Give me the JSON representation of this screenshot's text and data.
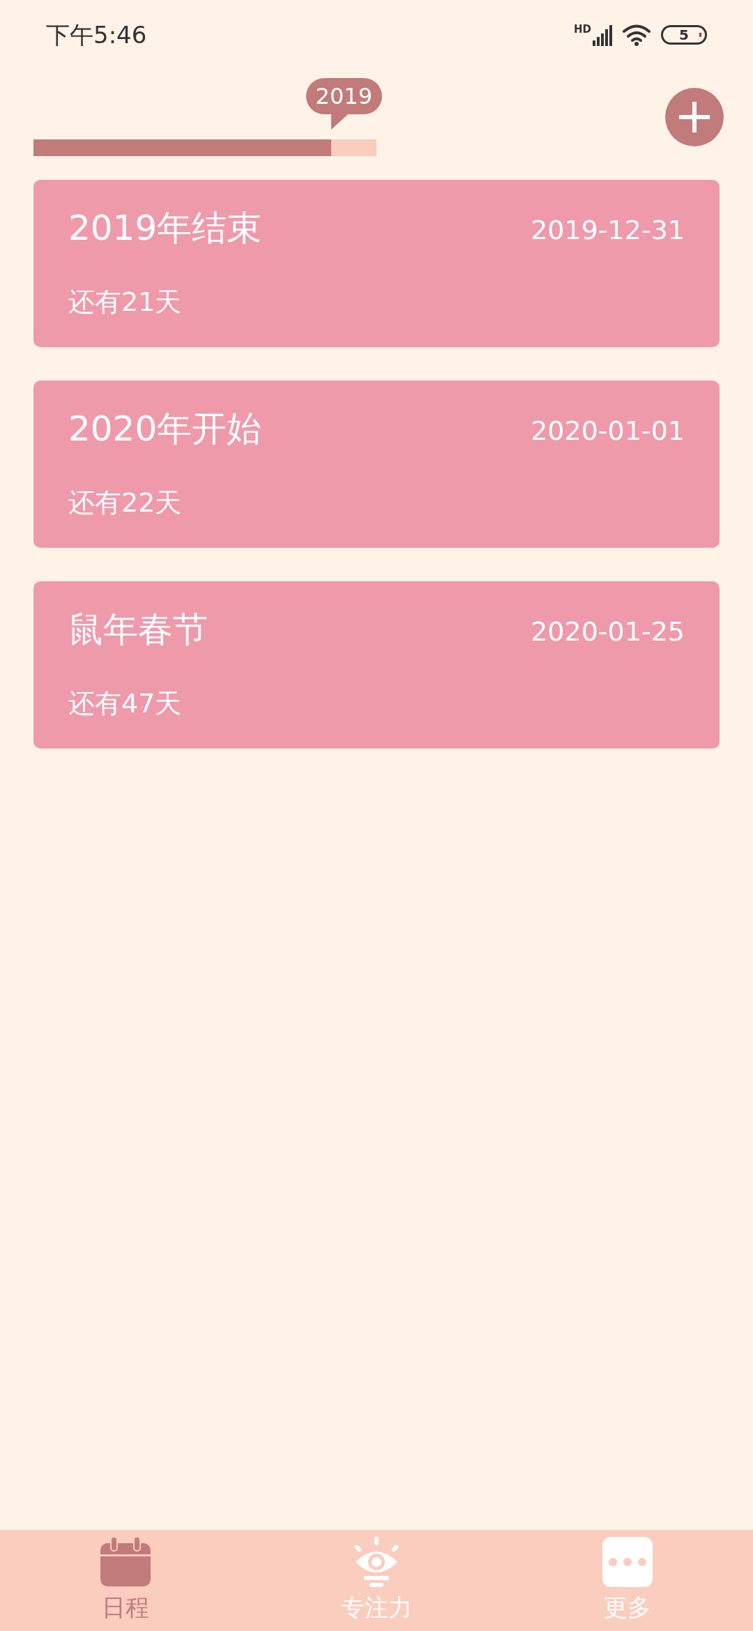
{
  "status_bar": {
    "time": "下午5:46",
    "network": "HD",
    "battery": "5"
  },
  "year_progress": {
    "year": "2019",
    "level": 0.867
  },
  "events": [
    {
      "title": "2019年结束",
      "date": "2019-12-31",
      "remaining": "还有21天"
    },
    {
      "title": "2020年开始",
      "date": "2020-01-01",
      "remaining": "还有22天"
    },
    {
      "title": "鼠年春节",
      "date": "2020-01-25",
      "remaining": "还有47天"
    }
  ],
  "tabs": [
    {
      "kind": "calendar",
      "label": "日程",
      "selected": true
    },
    {
      "kind": "focus",
      "label": "专注力",
      "selected": false
    },
    {
      "kind": "more",
      "label": "更多",
      "selected": false
    }
  ]
}
